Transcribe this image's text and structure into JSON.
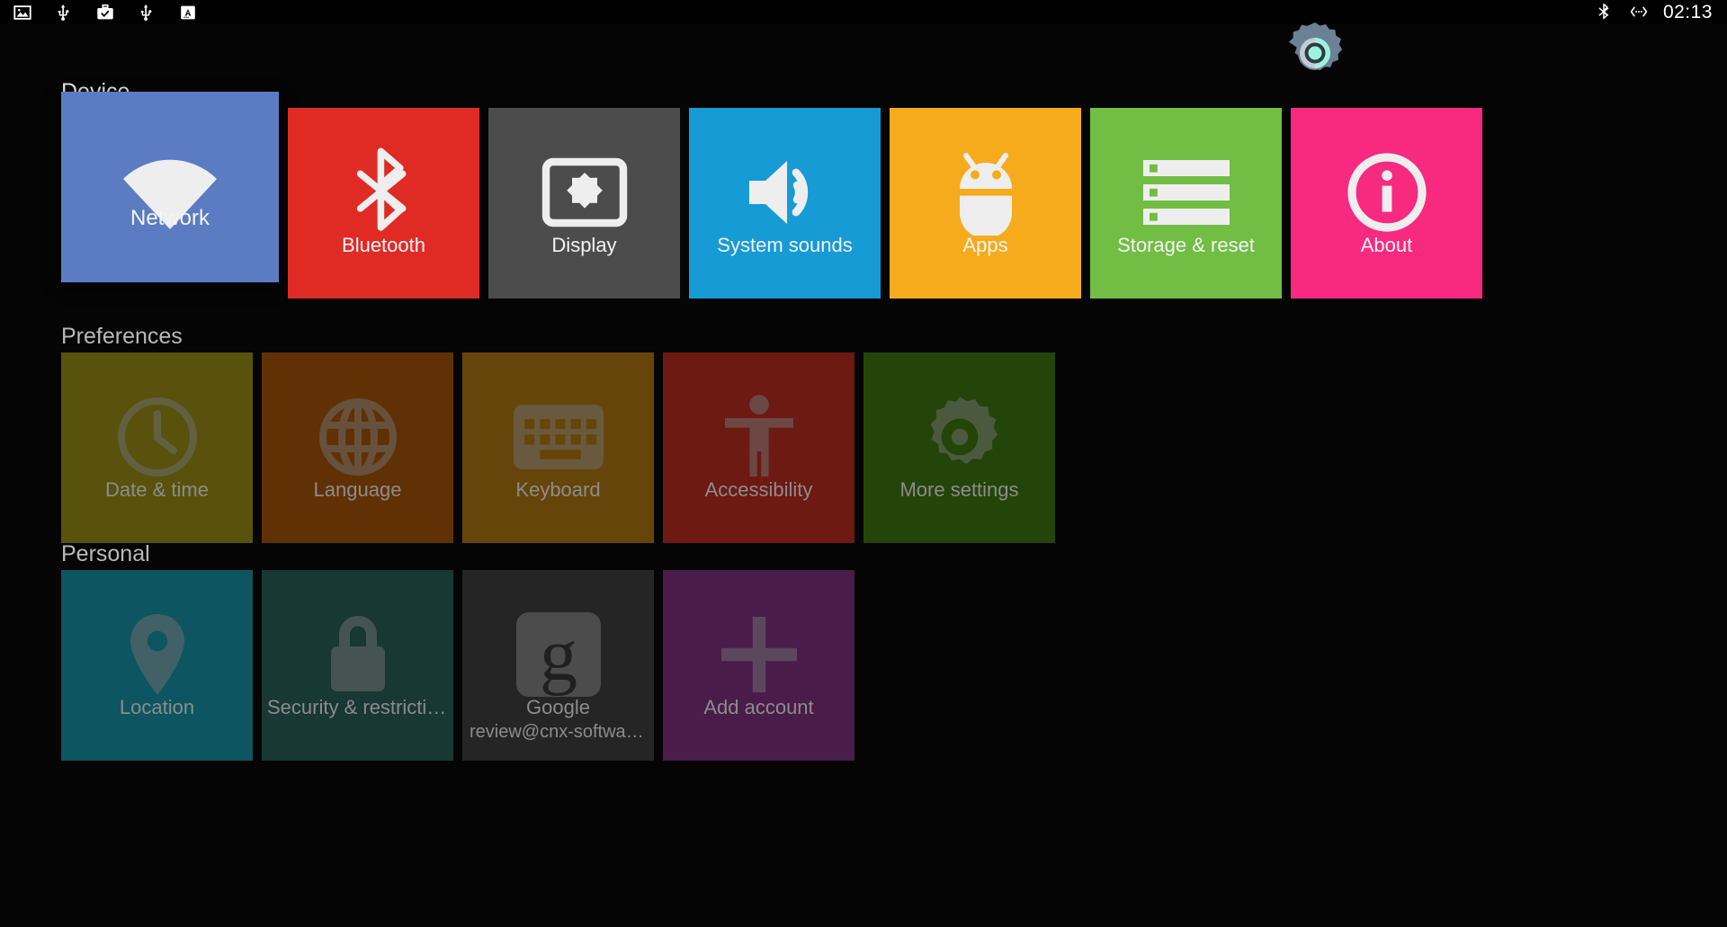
{
  "statusbar": {
    "left_icons": [
      {
        "name": "image-icon",
        "glyph": "image"
      },
      {
        "name": "usb-icon",
        "glyph": "usb"
      },
      {
        "name": "work-checked-icon",
        "glyph": "briefcase-check"
      },
      {
        "name": "usb-icon-2",
        "glyph": "usb"
      },
      {
        "name": "input-method-icon",
        "glyph": "letter-a"
      }
    ],
    "right_icons": [
      {
        "name": "bluetooth-icon",
        "glyph": "bluetooth"
      },
      {
        "name": "ethernet-icon",
        "glyph": "ethernet"
      }
    ],
    "clock": "02:13"
  },
  "logo": {
    "name": "settings-gear-logo",
    "gear_color": "#6a8293",
    "ring_color": "#9bd9c9",
    "inner_color": "#9ef2dd"
  },
  "sections": [
    {
      "id": "device",
      "title": "Device",
      "focused": true,
      "tiles": [
        {
          "label": "Network",
          "icon": "wifi-icon",
          "color": "#5b7cc2",
          "selected": true
        },
        {
          "label": "Bluetooth",
          "icon": "bluetooth-icon",
          "color": "#e02b25",
          "selected": false
        },
        {
          "label": "Display",
          "icon": "brightness-icon",
          "color": "#4c4c4c",
          "selected": false
        },
        {
          "label": "System sounds",
          "icon": "volume-icon",
          "color": "#169bd5",
          "selected": false
        },
        {
          "label": "Apps",
          "icon": "android-icon",
          "color": "#f5ab1c",
          "selected": false
        },
        {
          "label": "Storage & reset",
          "icon": "storage-icon",
          "color": "#72bd44",
          "selected": false
        },
        {
          "label": "About",
          "icon": "info-icon",
          "color": "#f72a7f",
          "selected": false
        }
      ]
    },
    {
      "id": "preferences",
      "title": "Preferences",
      "focused": false,
      "tiles": [
        {
          "label": "Date & time",
          "icon": "clock-icon",
          "color": "#59520d",
          "selected": false
        },
        {
          "label": "Language",
          "icon": "globe-icon",
          "color": "#603105",
          "selected": false
        },
        {
          "label": "Keyboard",
          "icon": "keyboard-icon",
          "color": "#66450a",
          "selected": false
        },
        {
          "label": "Accessibility",
          "icon": "accessibility-icon",
          "color": "#6d1a12",
          "selected": false
        },
        {
          "label": "More settings",
          "icon": "gear-icon",
          "color": "#23450a",
          "selected": false
        }
      ]
    },
    {
      "id": "personal",
      "title": "Personal",
      "focused": false,
      "tiles": [
        {
          "label": "Location",
          "icon": "location-pin-icon",
          "color": "#0d5560",
          "selected": false
        },
        {
          "label": "Security & restrictions",
          "icon": "lock-icon",
          "color": "#173833",
          "selected": false
        },
        {
          "label": "Google",
          "icon": "google-g-icon",
          "color": "#252525",
          "selected": false,
          "sublabel": "review@cnx-software.c…"
        },
        {
          "label": "Add account",
          "icon": "plus-icon",
          "color": "#4a1c4a",
          "selected": false
        }
      ]
    }
  ]
}
